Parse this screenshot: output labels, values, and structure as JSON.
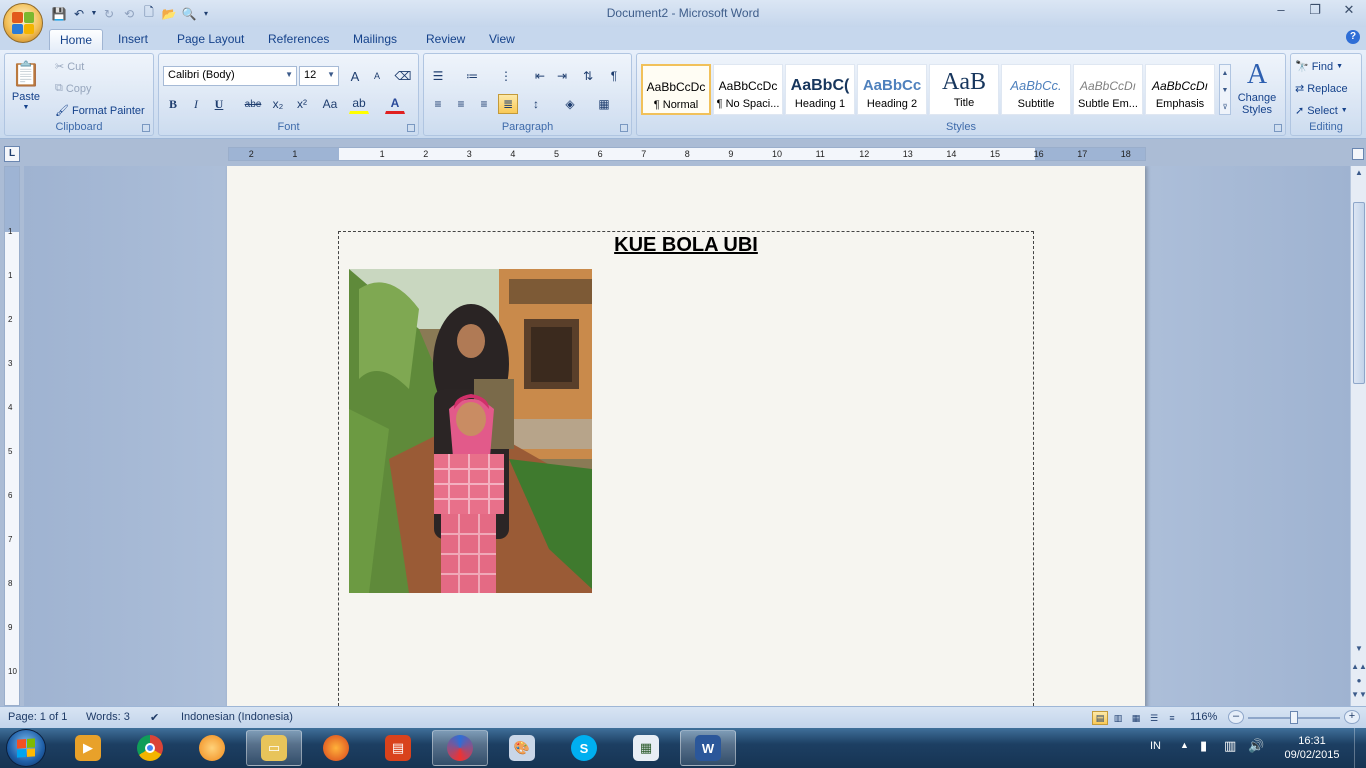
{
  "window": {
    "title": "Document2 - Microsoft Word",
    "controls": {
      "minimize": "–",
      "maximize": "❐",
      "close": "✕"
    }
  },
  "tabs": [
    "Home",
    "Insert",
    "Page Layout",
    "References",
    "Mailings",
    "Review",
    "View"
  ],
  "active_tab": "Home",
  "clipboard": {
    "label": "Clipboard",
    "paste": "Paste",
    "cut": "Cut",
    "copy": "Copy",
    "format_painter": "Format Painter"
  },
  "font": {
    "label": "Font",
    "font_name": "Calibri (Body)",
    "font_size": "12",
    "bold": "B",
    "italic": "I",
    "underline": "U",
    "strike": "abe",
    "subscript": "x₂",
    "superscript": "x²",
    "change_case": "Aa",
    "grow": "A",
    "shrink": "A",
    "font_color": "A"
  },
  "paragraph": {
    "label": "Paragraph",
    "pilcrow": "¶"
  },
  "styles": {
    "label": "Styles",
    "items": [
      {
        "sample": "AaBbCcDc",
        "name": "¶ Normal"
      },
      {
        "sample": "AaBbCcDc",
        "name": "¶ No Spaci..."
      },
      {
        "sample": "AaBbC(",
        "name": "Heading 1"
      },
      {
        "sample": "AaBbCc",
        "name": "Heading 2"
      },
      {
        "sample": "AaB",
        "name": "Title"
      },
      {
        "sample": "AaBbCc.",
        "name": "Subtitle"
      },
      {
        "sample": "AaBbCcDı",
        "name": "Subtle Em..."
      },
      {
        "sample": "AaBbCcDı",
        "name": "Emphasis"
      }
    ],
    "selected_index": 0,
    "change_styles": "Change Styles"
  },
  "editing": {
    "label": "Editing",
    "find": "Find",
    "replace": "Replace",
    "select": "Select"
  },
  "ruler": {
    "corner": "L",
    "h_ticks": [
      "2",
      "1",
      "1",
      "2",
      "3",
      "4",
      "5",
      "6",
      "7",
      "8",
      "9",
      "10",
      "11",
      "12",
      "13",
      "14",
      "15",
      "16",
      "17",
      "18"
    ],
    "v_ticks": [
      "1",
      "1",
      "2",
      "3",
      "4",
      "5",
      "6",
      "7",
      "8",
      "9",
      "10"
    ]
  },
  "document": {
    "heading": "KUE BOLA UBI"
  },
  "status": {
    "page": "Page: 1 of 1",
    "words": "Words: 3",
    "language": "Indonesian (Indonesia)",
    "zoom": "116%"
  },
  "taskbar": {
    "lang": "IN",
    "time": "16:31",
    "date": "09/02/2015"
  },
  "colors": {
    "ribbon_text": "#15428b",
    "accent_selected": "#f1c15a"
  }
}
